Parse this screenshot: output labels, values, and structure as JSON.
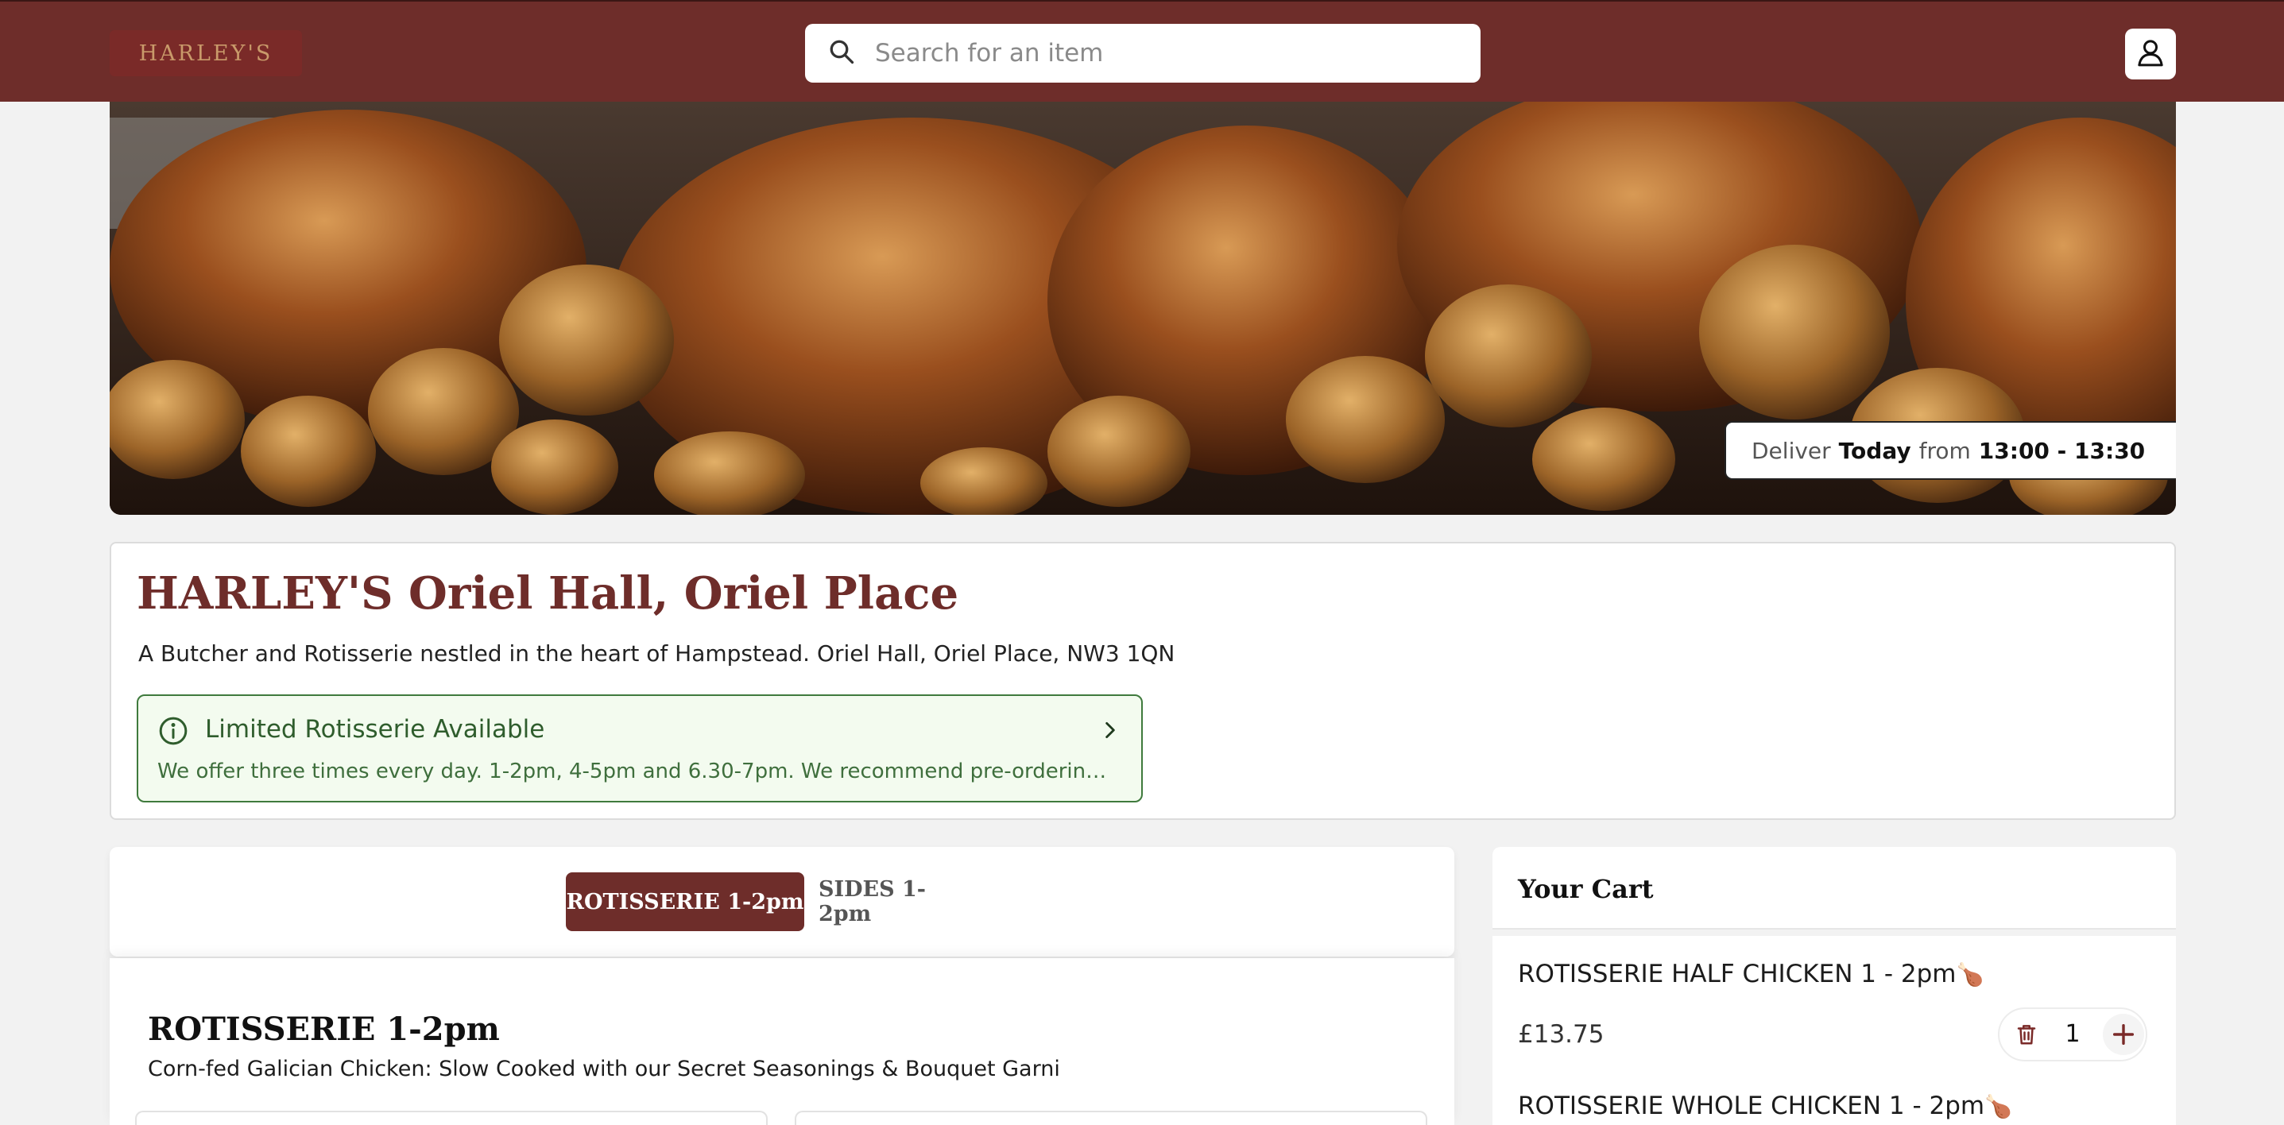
{
  "header": {
    "logo_text": "HARLEY'S",
    "search_placeholder": "Search for an item",
    "icons": {
      "search": "search-icon",
      "account": "user-icon"
    }
  },
  "hero": {
    "deliver_prefix": "Deliver",
    "deliver_day": "Today",
    "deliver_from": "from",
    "deliver_window": "13:00 - 13:30"
  },
  "restaurant": {
    "brand": "HARLEY'S",
    "location": "Oriel Hall, Oriel Place",
    "description": "A Butcher and Rotisserie nestled in the heart of Hampstead. Oriel Hall, Oriel Place, NW3 1QN",
    "notice": {
      "title": "Limited Rotisserie Available",
      "body": "We offer three times every day. 1-2pm, 4-5pm and 6.30-7pm. We recommend pre-ordering..."
    }
  },
  "menu": {
    "tabs": [
      {
        "label": "ROTISSERIE 1-2pm",
        "active": true
      },
      {
        "label": "SIDES 1-2pm",
        "active": false
      }
    ],
    "section": {
      "title": "ROTISSERIE 1-2pm",
      "subtitle": "Corn-fed Galician Chicken: Slow Cooked with our Secret Seasonings & Bouquet Garni"
    }
  },
  "cart": {
    "title": "Your Cart",
    "items": [
      {
        "name": "ROTISSERIE HALF CHICKEN 1 - 2pm",
        "emoji": "🍗",
        "price": "£13.75",
        "quantity": "1"
      },
      {
        "name": "ROTISSERIE WHOLE CHICKEN 1 - 2pm",
        "emoji": "🍗"
      }
    ]
  },
  "colors": {
    "brand": "#6e2d2a",
    "notice_bg": "#f3fbef",
    "notice_border": "#3f7a3d",
    "page_bg": "#f2f2f2"
  }
}
